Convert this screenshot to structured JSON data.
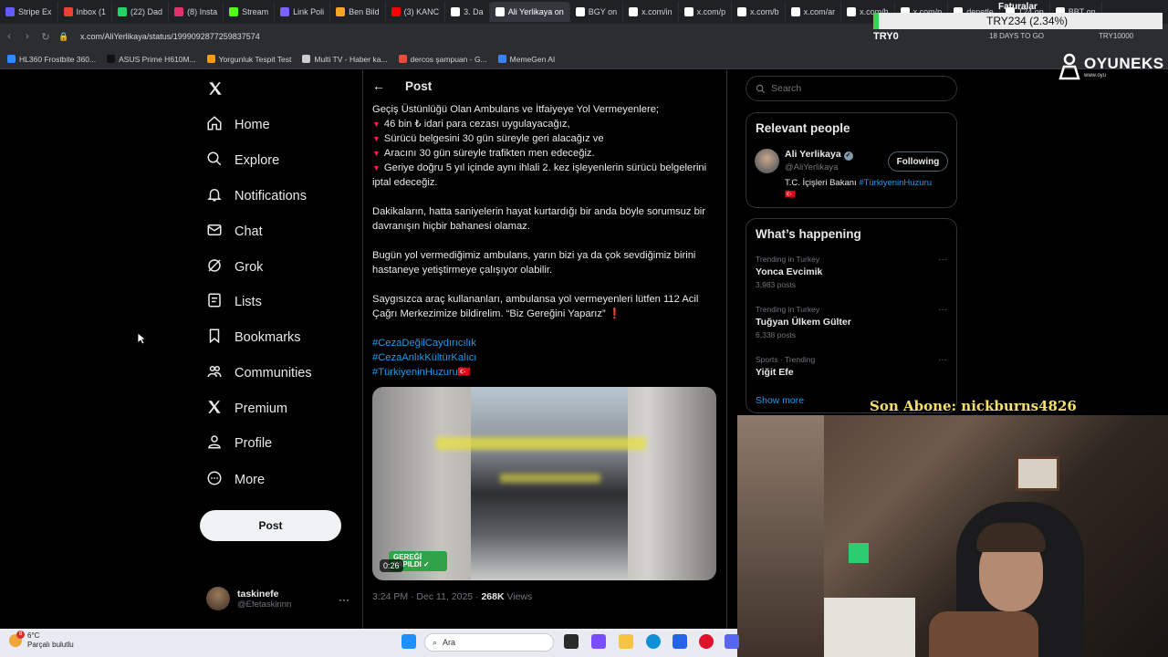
{
  "browser": {
    "tabs": [
      {
        "label": "Stripe Ex",
        "color": "#635bff"
      },
      {
        "label": "Inbox (1",
        "color": "#ea4335"
      },
      {
        "label": "(22) Dad",
        "color": "#25d366"
      },
      {
        "label": "(8) Insta",
        "color": "#e1306c"
      },
      {
        "label": "Stream",
        "color": "#53fc18"
      },
      {
        "label": "Link Poli",
        "color": "#7b61ff"
      },
      {
        "label": "Ben Bild",
        "color": "#f5a623"
      },
      {
        "label": "(3) KANC",
        "color": "#ff0000"
      },
      {
        "label": "3. Da",
        "color": "#ffffff"
      },
      {
        "label": "Ali Yerlikaya on",
        "color": "#ffffff"
      },
      {
        "label": "BGY on",
        "color": "#ffffff"
      },
      {
        "label": "x.com/in",
        "color": "#ffffff"
      },
      {
        "label": "x.com/p",
        "color": "#ffffff"
      },
      {
        "label": "x.com/b",
        "color": "#ffffff"
      },
      {
        "label": "x.com/ar",
        "color": "#ffffff"
      },
      {
        "label": "x.com/h",
        "color": "#ffffff"
      },
      {
        "label": "x.com/p",
        "color": "#ffffff"
      },
      {
        "label": "denetle",
        "color": "#ffffff"
      },
      {
        "label": "T24 on",
        "color": "#ffffff"
      },
      {
        "label": "BBT on",
        "color": "#ffffff"
      }
    ],
    "active_tab_index": 9,
    "url": "x.com/AliYerlikaya/status/1999092877259837574",
    "bookmarks": [
      {
        "label": "HL360 Frostbite 360...",
        "color": "#2b8cff"
      },
      {
        "label": "ASUS Prime H610M...",
        "color": "#111111"
      },
      {
        "label": "Yorgunluk Tespit Test",
        "color": "#f39c12"
      },
      {
        "label": "Multi TV - Haber ka...",
        "color": "#cccccc"
      },
      {
        "label": "dercos şampuan - G...",
        "color": "#e74c3c"
      },
      {
        "label": "MemeGen AI",
        "color": "#3b82f6"
      }
    ]
  },
  "overlay": {
    "stock_value": "TRY234 (2.34%)",
    "stock_label": "TRY0",
    "stock_days": "18 DAYS TO GO",
    "stock_right": "TRY10000",
    "faturalar": "Faturalar",
    "brand_name": "OYUNEKS",
    "brand_sub": "www.oyu",
    "subscriber_text": "Son Abone: nickburns4826"
  },
  "nav": {
    "items": [
      {
        "label": "Home",
        "icon": "home-icon"
      },
      {
        "label": "Explore",
        "icon": "search-icon"
      },
      {
        "label": "Notifications",
        "icon": "bell-icon"
      },
      {
        "label": "Chat",
        "icon": "mail-icon"
      },
      {
        "label": "Grok",
        "icon": "grok-icon"
      },
      {
        "label": "Lists",
        "icon": "list-icon"
      },
      {
        "label": "Bookmarks",
        "icon": "bookmark-icon"
      },
      {
        "label": "Communities",
        "icon": "communities-icon"
      },
      {
        "label": "Premium",
        "icon": "x-logo-icon"
      },
      {
        "label": "Profile",
        "icon": "person-icon"
      },
      {
        "label": "More",
        "icon": "more-circle-icon"
      }
    ],
    "post_button": "Post",
    "account_name": "taskinefe",
    "account_handle": "@Efetaskinnn"
  },
  "post": {
    "header": "Post",
    "intro": "Geçiş Üstünlüğü Olan Ambulans ve İtfaiyeye Yol Vermeyenlere;",
    "bullets": [
      "46 bin ₺ idari para cezası uygulayacağız,",
      "Sürücü belgesini 30 gün süreyle geri alacağız ve",
      "Aracını 30 gün süreyle trafikten men edeceğiz.",
      "Geriye doğru 5 yıl içinde aynı ihlali 2. kez işleyenlerin sürücü belgelerini iptal edeceğiz."
    ],
    "paragraphs": [
      "Dakikaların, hatta saniyelerin hayat kurtardığı bir anda böyle sorumsuz bir davranışın hiçbir bahanesi olamaz.",
      "Bugün yol vermediğimiz ambulans, yarın bizi ya da çok sevdiğimiz birini hastaneye yetiştirmeye çalışıyor olabilir.",
      "Saygısızca araç kullananları, ambulansa yol vermeyenleri lütfen 112 Acil Çağrı Merkezimize bildirelim. “Biz Gereğini Yaparız” ❗"
    ],
    "hashtags": [
      "#CezaDeğilCaydırıcılık",
      "#CezaAnlıkKültürKalıcı",
      "#TürkiyeninHuzuru🇹🇷"
    ],
    "video_duration": "0:26",
    "video_badge": "GEREĞİ YAPILDI ✓",
    "timestamp": "3:24 PM · Dec 11, 2025 · ",
    "views_count": "268K",
    "views_label": " Views"
  },
  "sidebar": {
    "search_placeholder": "Search",
    "relevant_title": "Relevant people",
    "person": {
      "name": "Ali Yerlikaya",
      "handle": "@AliYerlikaya",
      "bio": "T.C. İçişleri Bakanı ",
      "bio_tag": "#TürkiyeninHuzuru",
      "flag": "🇹🇷",
      "follow_label": "Following"
    },
    "happening_title": "What’s happening",
    "trends": [
      {
        "category": "Trending in Turkey",
        "name": "Yonca Evcimik",
        "posts": "3,983 posts"
      },
      {
        "category": "Trending in Turkey",
        "name": "Tuğyan Ülkem Gülter",
        "posts": "6,338 posts"
      },
      {
        "category": "Sports · Trending",
        "name": "Yiğit Efe",
        "posts": ""
      }
    ],
    "show_more": "Show more"
  },
  "taskbar": {
    "temperature": "6°C",
    "weather": "Parçalı bulutlu",
    "badge": "8",
    "search_label": "Ara"
  }
}
